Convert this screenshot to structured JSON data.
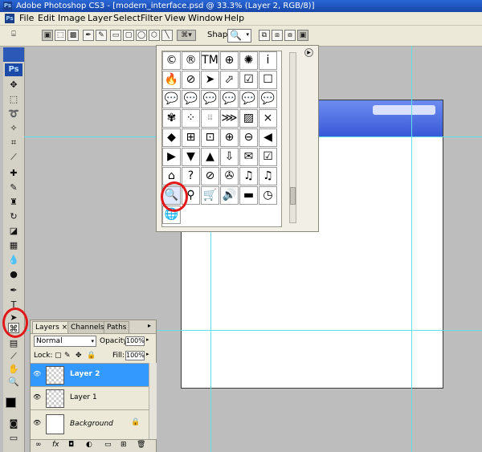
{
  "window": {
    "title": "Adobe Photoshop CS3 - [modern_interface.psd @ 33.3% (Layer 2, RGB/8)]",
    "app_badge": "Ps"
  },
  "menu": [
    "File",
    "Edit",
    "Image",
    "Layer",
    "Select",
    "Filter",
    "View",
    "Window",
    "Help"
  ],
  "options": {
    "shape_label": "Shape:",
    "shape_glyph": "🔍"
  },
  "toolbox": {
    "badge": "Ps"
  },
  "popup": {
    "rows": [
      [
        "©",
        "®",
        "TM",
        "⊕",
        "✺",
        "i"
      ],
      [
        "🔥",
        "⊘",
        "➤",
        "⬀",
        "☑",
        "☐"
      ],
      [
        "💬",
        "💬",
        "💬",
        "💬",
        "💬",
        "💬"
      ],
      [
        "✾",
        "⁘",
        "⦙⦙⦙",
        "⋙",
        "▨",
        "⨯"
      ],
      [
        "◆",
        "⊞",
        "⊡",
        "⊕",
        "⊖",
        "◀"
      ],
      [
        "▶",
        "▼",
        "▲",
        "⇩",
        "✉",
        "☑"
      ],
      [
        "⌂",
        "?",
        "⊘",
        "✇",
        "♫",
        "♫"
      ],
      [
        "🔍",
        "⚲",
        "🛒",
        "🔊",
        "▬",
        "◷"
      ],
      [
        "🌐"
      ]
    ]
  },
  "layers": {
    "tabs": [
      "Layers ×",
      "Channels",
      "Paths"
    ],
    "blend_mode": "Normal",
    "opacity_label": "Opacity:",
    "opacity": "100%",
    "lock_label": "Lock:",
    "fill_label": "Fill:",
    "fill": "100%",
    "rows": [
      {
        "name": "Layer 2"
      },
      {
        "name": "Layer 1"
      },
      {
        "name": "Background"
      }
    ]
  },
  "colors": {
    "accent": "#3399ff",
    "header_blue": "#4a6be0",
    "annotation": "#e01818",
    "guide": "#5fe0e6"
  }
}
